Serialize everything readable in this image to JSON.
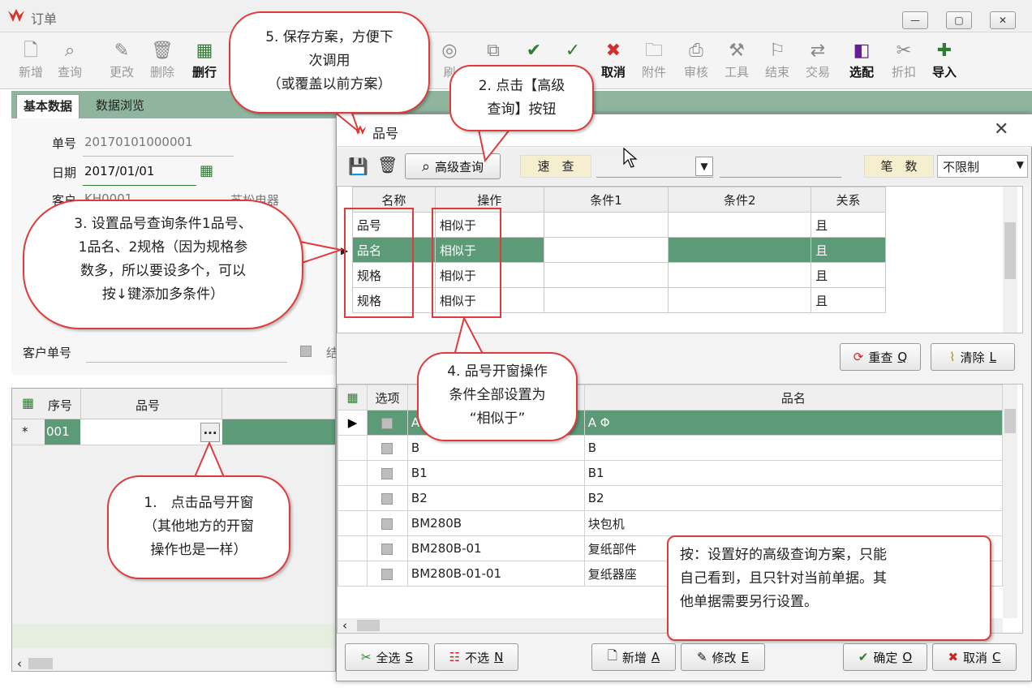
{
  "window": {
    "title": "订单",
    "min": "—",
    "max": "▢",
    "close": "✕"
  },
  "toolbar": [
    "新增",
    "查询",
    "更改",
    "删除",
    "删行",
    "刷",
    "",
    "",
    "",
    "取消",
    "附件",
    "审核",
    "工具",
    "结束",
    "交易",
    "选配",
    "折扣",
    "导入"
  ],
  "tabs": [
    "基本数据",
    "数据浏览"
  ],
  "form": {
    "no_label": "单号",
    "no_value": "20170101000001",
    "date_label": "日期",
    "date_value": "2017/01/01",
    "cust_label": "客户",
    "cust_value": "KH0001",
    "cust_name": "苏松电器",
    "cust_order_label": "客户单号",
    "check_label": "结"
  },
  "left_grid": {
    "headers": [
      "序号",
      "品号"
    ],
    "row_marker": "*",
    "row_no": "001",
    "ellipsis": "..."
  },
  "dialog": {
    "title": "品号",
    "adv_query": "高级查询",
    "quick_label": "速　查",
    "count_label": "笔　数",
    "count_value": "不限制",
    "cond_headers": [
      "名称",
      "操作",
      "条件1",
      "条件2",
      "关系"
    ],
    "cond_rows": [
      {
        "name": "品号",
        "op": "相似于",
        "c1": "",
        "c2": "",
        "rel": "且"
      },
      {
        "name": "品名",
        "op": "相似于",
        "c1": "",
        "c2": "",
        "rel": "且"
      },
      {
        "name": "规格",
        "op": "相似于",
        "c1": "",
        "c2": "",
        "rel": "且"
      },
      {
        "name": "规格",
        "op": "相似于",
        "c1": "",
        "c2": "",
        "rel": "且"
      }
    ],
    "requery": "重查",
    "requery_key": "Q",
    "clear": "清除",
    "clear_key": "L",
    "res_headers": [
      "选项",
      "品号",
      "品名"
    ],
    "res_rows": [
      {
        "code": "A",
        "name": "A Φ"
      },
      {
        "code": "B",
        "name": "B"
      },
      {
        "code": "B1",
        "name": "B1"
      },
      {
        "code": "B2",
        "name": "B2"
      },
      {
        "code": "BM280B",
        "name": "块包机"
      },
      {
        "code": "BM280B-01",
        "name": "复纸部件"
      },
      {
        "code": "BM280B-01-01",
        "name": "复纸器座"
      }
    ],
    "btn_all": "全选",
    "btn_all_key": "S",
    "btn_none": "不选",
    "btn_none_key": "N",
    "btn_new": "新增",
    "btn_new_key": "A",
    "btn_edit": "修改",
    "btn_edit_key": "E",
    "btn_ok": "确定",
    "btn_ok_key": "O",
    "btn_cancel": "取消",
    "btn_cancel_key": "C"
  },
  "callouts": {
    "c1": "1.　点击品号开窗\n（其他地方的开窗\n操作也是一样）",
    "c2": "2. 点击【高级\n查询】按钮",
    "c3": "3. 设置品号查询条件1品号、\n1品名、2规格（因为规格参\n数多，所以要设多个，可以\n按↓键添加多条件）",
    "c4": "4. 品号开窗操作\n条件全部设置为\n“相似于”",
    "c5": "5. 保存方案，方便下\n次调用\n（或覆盖以前方案）",
    "note": "按：设置好的高级查询方案，只能\n自己看到，且只针对当前单据。其\n他单据需要另行设置。"
  }
}
